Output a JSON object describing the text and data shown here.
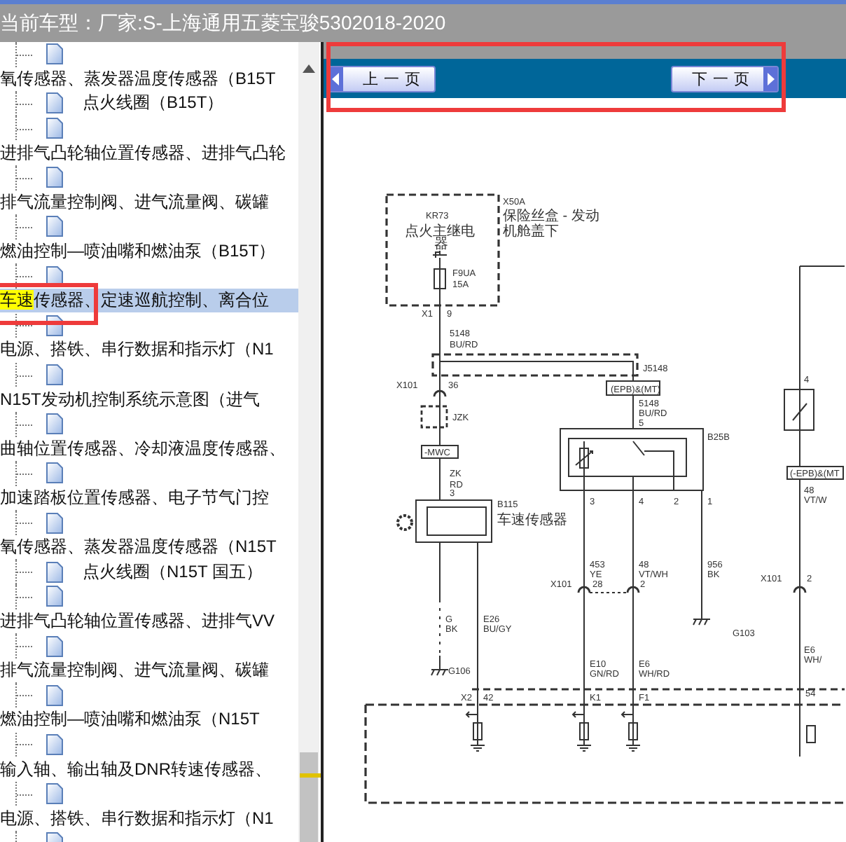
{
  "header": {
    "label": "当前车型：",
    "value": "厂家:S-上海通用五菱宝骏5302018-2020"
  },
  "tree": {
    "items": [
      {
        "kind": "wrapped",
        "label": "氧传感器、蒸发器温度传感器（B15T",
        "selected": false
      },
      {
        "kind": "inline",
        "label": "点火线圈（B15T）",
        "selected": false
      },
      {
        "kind": "wrapped",
        "label": "进排气凸轮轴位置传感器、进排气凸轮",
        "selected": false
      },
      {
        "kind": "wrapped",
        "label": "排气流量控制阀、进气流量阀、碳罐",
        "selected": false
      },
      {
        "kind": "wrapped",
        "label": "燃油控制—喷油嘴和燃油泵（B15T）",
        "selected": false
      },
      {
        "kind": "wrapped",
        "highlight": "车速",
        "label": "传感器、定速巡航控制、离合位",
        "selected": true
      },
      {
        "kind": "wrapped",
        "label": "电源、搭铁、串行数据和指示灯（N1",
        "selected": false
      },
      {
        "kind": "wrapped",
        "label": "N15T发动机控制系统示意图（进气",
        "selected": false
      },
      {
        "kind": "wrapped",
        "label": "曲轴位置传感器、冷却液温度传感器、",
        "selected": false
      },
      {
        "kind": "wrapped",
        "label": "加速踏板位置传感器、电子节气门控",
        "selected": false
      },
      {
        "kind": "wrapped",
        "label": "氧传感器、蒸发器温度传感器（N15T",
        "selected": false
      },
      {
        "kind": "inline",
        "label": "点火线圈（N15T 国五）",
        "selected": false
      },
      {
        "kind": "wrapped",
        "label": "进排气凸轮轴位置传感器、进排气VV",
        "selected": false
      },
      {
        "kind": "wrapped",
        "label": "排气流量控制阀、进气流量阀、碳罐",
        "selected": false
      },
      {
        "kind": "wrapped",
        "label": "燃油控制—喷油嘴和燃油泵（N15T",
        "selected": false
      },
      {
        "kind": "wrapped",
        "label": "输入轴、输出轴及DNR转速传感器、",
        "selected": false
      },
      {
        "kind": "wrapped",
        "label": "电源、搭铁、串行数据和指示灯（N1",
        "selected": false
      },
      {
        "kind": "icon_only",
        "selected": false
      }
    ]
  },
  "nav": {
    "prev": "上一页",
    "next": "下一页"
  },
  "diagram": {
    "labels": [
      "X50A",
      "保险丝盒 - 发动",
      "机舱盖下",
      "KR73",
      "点火主继电",
      "器",
      "F9UA",
      "15A",
      "X1",
      "9",
      "5148",
      "BU/RD",
      "J5148",
      "X101",
      "36",
      "JZK",
      "-MWC",
      "ZK",
      "RD",
      "3",
      "B115",
      "车速传感器",
      "(EPB)&(MT)",
      "5148",
      "BU/RD",
      "5",
      "B25B",
      "3",
      "4",
      "2",
      "1",
      "453",
      "YE",
      "48",
      "VT/WH",
      "956",
      "BK",
      "X101",
      "28",
      "2",
      "G103",
      "G",
      "BK",
      "E26",
      "BU/GY",
      "G106",
      "X2",
      "42",
      "K1",
      "F1",
      "4",
      "(-EPB)&(MT",
      "48",
      "VT/W",
      "X101",
      "2",
      "E6",
      "WH/",
      "54",
      "E10",
      "GN/RD",
      "E6",
      "WH/RD"
    ]
  },
  "annotations": {
    "nav_frame": true,
    "tree_frame": true
  }
}
